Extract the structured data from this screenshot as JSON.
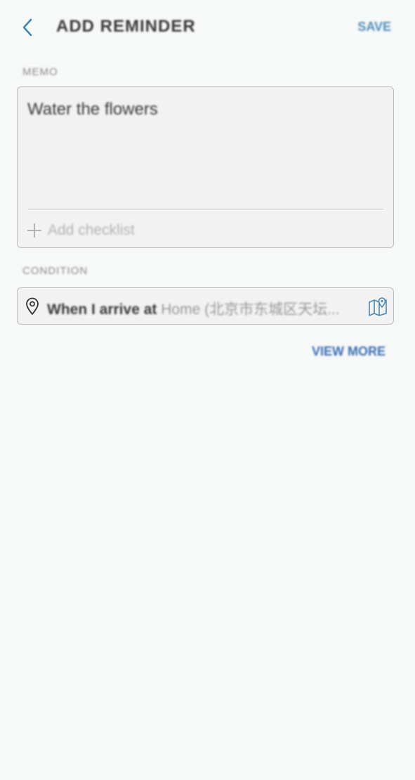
{
  "header": {
    "title": "ADD REMINDER",
    "save_label": "SAVE",
    "back_icon": "chevron-left-icon"
  },
  "memo": {
    "label": "MEMO",
    "text": "Water the flowers",
    "add_checklist_label": "Add checklist"
  },
  "condition": {
    "label": "CONDITION",
    "prefix": "When I arrive at",
    "place": "Home (北京市东城区天坛...",
    "pin_icon": "location-pin-icon",
    "map_icon": "map-icon"
  },
  "view_more_label": "VIEW MORE",
  "colors": {
    "background": "#f7f8f8",
    "accent": "#4f8fb8",
    "link": "#3a6fb5"
  }
}
